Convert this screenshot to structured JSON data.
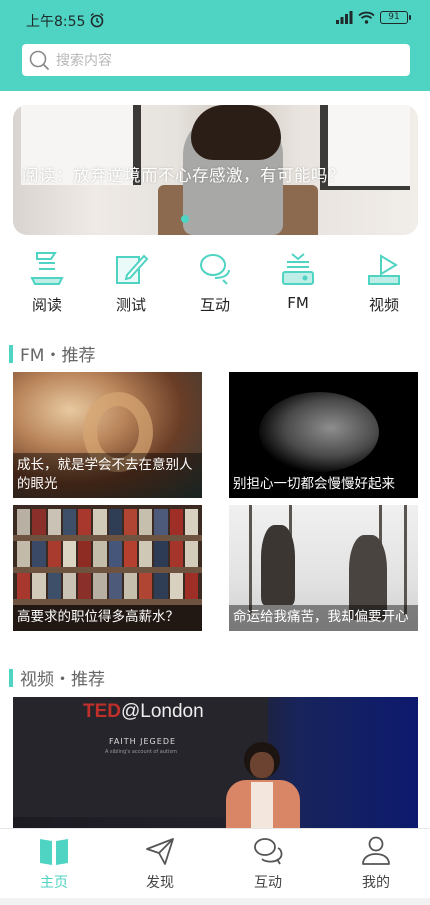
{
  "status_bar": {
    "time": "上午8:55",
    "battery": "91"
  },
  "search": {
    "placeholder": "搜索内容"
  },
  "banner": {
    "title": "阅读：放弃逆境而不心存感激，有可能吗？"
  },
  "nav": {
    "items": [
      {
        "label": "阅读",
        "icon": "reading-icon"
      },
      {
        "label": "测试",
        "icon": "test-icon"
      },
      {
        "label": "互动",
        "icon": "chat-icon"
      },
      {
        "label": "FM",
        "icon": "radio-icon"
      },
      {
        "label": "视频",
        "icon": "video-icon"
      }
    ]
  },
  "fm_section": {
    "title": "FM・推荐",
    "cards": [
      {
        "caption": "成长，就是学会不去在意别人的眼光"
      },
      {
        "caption": "别担心一切都会慢慢好起来"
      },
      {
        "caption": "高要求的职位得多高薪水？"
      },
      {
        "caption": "命运给我痛苦，我却偏要开心"
      }
    ]
  },
  "video_section": {
    "title": "视频・推荐",
    "ted_brand": "TED",
    "ted_location": "@London",
    "speaker_name": "FAITH JEGEDE",
    "talk_subtitle": "A sibling's account of autism"
  },
  "tabbar": {
    "items": [
      {
        "label": "主页",
        "icon": "book-icon",
        "active": true
      },
      {
        "label": "发现",
        "icon": "send-icon",
        "active": false
      },
      {
        "label": "互动",
        "icon": "chat-bubbles-icon",
        "active": false
      },
      {
        "label": "我的",
        "icon": "user-icon",
        "active": false
      }
    ]
  },
  "colors": {
    "accent": "#4fd3c3"
  }
}
